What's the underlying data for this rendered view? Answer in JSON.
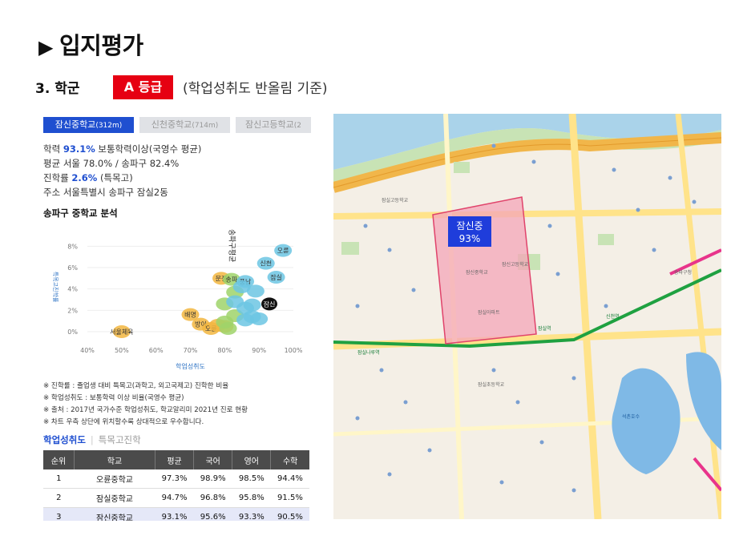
{
  "header": {
    "title_icon": "▶",
    "title": "입지평가",
    "subtitle": "3.  학군",
    "grade": "A 등급",
    "grade_note": "(학업성취도 반올림 기준)"
  },
  "tabs": [
    {
      "label": "잠신중학교",
      "dist": "(312m)"
    },
    {
      "label": "신천중학교",
      "dist": "(714m)"
    },
    {
      "label": "잠신고등학교",
      "dist": "(2"
    }
  ],
  "info": {
    "l1_label": "학력 ",
    "l1_value": "93.1%",
    "l1_rest": " 보통학력이상(국영수 평균)",
    "l2": "평균 서울 78.0% / 송파구 82.4%",
    "l3_label": "진학률 ",
    "l3_value": "2.6%",
    "l3_rest": " (특목고)",
    "l4": "주소 서울특별시 송파구 잠실2동"
  },
  "analysis_title": "송파구 중학교 분석",
  "chart_data": {
    "type": "scatter",
    "title": "송파구 중학교 분석",
    "xlabel": "학업성취도",
    "ylabel": "특목고진학률",
    "x_ticks": [
      "40%",
      "50%",
      "60%",
      "70%",
      "80%",
      "90%",
      "100%"
    ],
    "y_ticks": [
      "0%",
      "2%",
      "4%",
      "6%",
      "8%"
    ],
    "xlim": [
      40,
      100
    ],
    "ylim": [
      -0.6,
      9
    ],
    "points": [
      {
        "label": "서울체육",
        "x": 50,
        "y": 0,
        "color": "#f2b640"
      },
      {
        "label": "배명",
        "x": 70,
        "y": 1.6,
        "color": "#f2b640"
      },
      {
        "label": "방이",
        "x": 73,
        "y": 0.7,
        "color": "#f2b640"
      },
      {
        "label": "오륜",
        "x": 76,
        "y": 0.3,
        "color": "#f2b640"
      },
      {
        "label": "",
        "x": 78,
        "y": 0.6,
        "color": "#f2b640"
      },
      {
        "label": "",
        "x": 80,
        "y": 0.5,
        "color": "#f2b640"
      },
      {
        "label": "문정",
        "x": 79,
        "y": 5,
        "color": "#f2b640"
      },
      {
        "label": "송파",
        "x": 82,
        "y": 4.9,
        "color": "#9fd46a"
      },
      {
        "label": "",
        "x": 83,
        "y": 3.7,
        "color": "#9fd46a"
      },
      {
        "label": "",
        "x": 80,
        "y": 2.6,
        "color": "#9fd46a"
      },
      {
        "label": "",
        "x": 83,
        "y": 1.5,
        "color": "#9fd46a"
      },
      {
        "label": "",
        "x": 80,
        "y": 0.9,
        "color": "#9fd46a"
      },
      {
        "label": "",
        "x": 81,
        "y": 0.3,
        "color": "#9fd46a"
      },
      {
        "label": "풍납",
        "x": 86,
        "y": 4.7,
        "color": "#6cc6e3"
      },
      {
        "label": "",
        "x": 85,
        "y": 4.2,
        "color": "#6cc6e3"
      },
      {
        "label": "",
        "x": 83,
        "y": 2.8,
        "color": "#6cc6e3"
      },
      {
        "label": "",
        "x": 86,
        "y": 2.2,
        "color": "#6cc6e3"
      },
      {
        "label": "",
        "x": 88,
        "y": 1.4,
        "color": "#6cc6e3"
      },
      {
        "label": "",
        "x": 86,
        "y": 1.1,
        "color": "#6cc6e3"
      },
      {
        "label": "",
        "x": 90,
        "y": 1.2,
        "color": "#6cc6e3"
      },
      {
        "label": "",
        "x": 89,
        "y": 3.8,
        "color": "#6cc6e3"
      },
      {
        "label": "",
        "x": 88,
        "y": 2.5,
        "color": "#6cc6e3"
      },
      {
        "label": "신천",
        "x": 92,
        "y": 6.4,
        "color": "#6cc6e3"
      },
      {
        "label": "오륜",
        "x": 97,
        "y": 7.6,
        "color": "#6cc6e3"
      },
      {
        "label": "잠실",
        "x": 95,
        "y": 5.1,
        "color": "#6cc6e3"
      },
      {
        "label": "잠신",
        "x": 93,
        "y": 2.6,
        "color": "#111111"
      }
    ],
    "vertical_label": "송파구평균",
    "vertical_x": 82.4
  },
  "notes": [
    "※ 진학률 : 졸업생 대비 특목고(과학고, 외고국제고) 진학한 비율",
    "※ 학업성취도 : 보통학력 이상 비율(국영수 평균)",
    "※ 출처 : 2017년 국가수준 학업성취도, 학교알리미 2021년 진로 현황",
    "※ 차트 우측 상단에 위치할수록 상대적으로 우수합니다."
  ],
  "subtabs": {
    "active": "학업성취도",
    "inactive": "특목고진학"
  },
  "table": {
    "headers": [
      "순위",
      "학교",
      "평균",
      "국어",
      "영어",
      "수학"
    ],
    "rows": [
      [
        "1",
        "오륜중학교",
        "97.3%",
        "98.9%",
        "98.5%",
        "94.4%"
      ],
      [
        "2",
        "잠실중학교",
        "94.7%",
        "96.8%",
        "95.8%",
        "91.5%"
      ],
      [
        "3",
        "잠신중학교",
        "93.1%",
        "95.6%",
        "93.3%",
        "90.5%"
      ]
    ]
  },
  "map": {
    "area_label": "잠신중",
    "area_value": "93%",
    "labels": [
      "잠실고등학교",
      "잠신고등학교",
      "잠신중학교",
      "잠실초등학교",
      "석촌호수",
      "잠실역",
      "신천역",
      "잠실아파트",
      "송파구청",
      "잠실나루역"
    ]
  }
}
